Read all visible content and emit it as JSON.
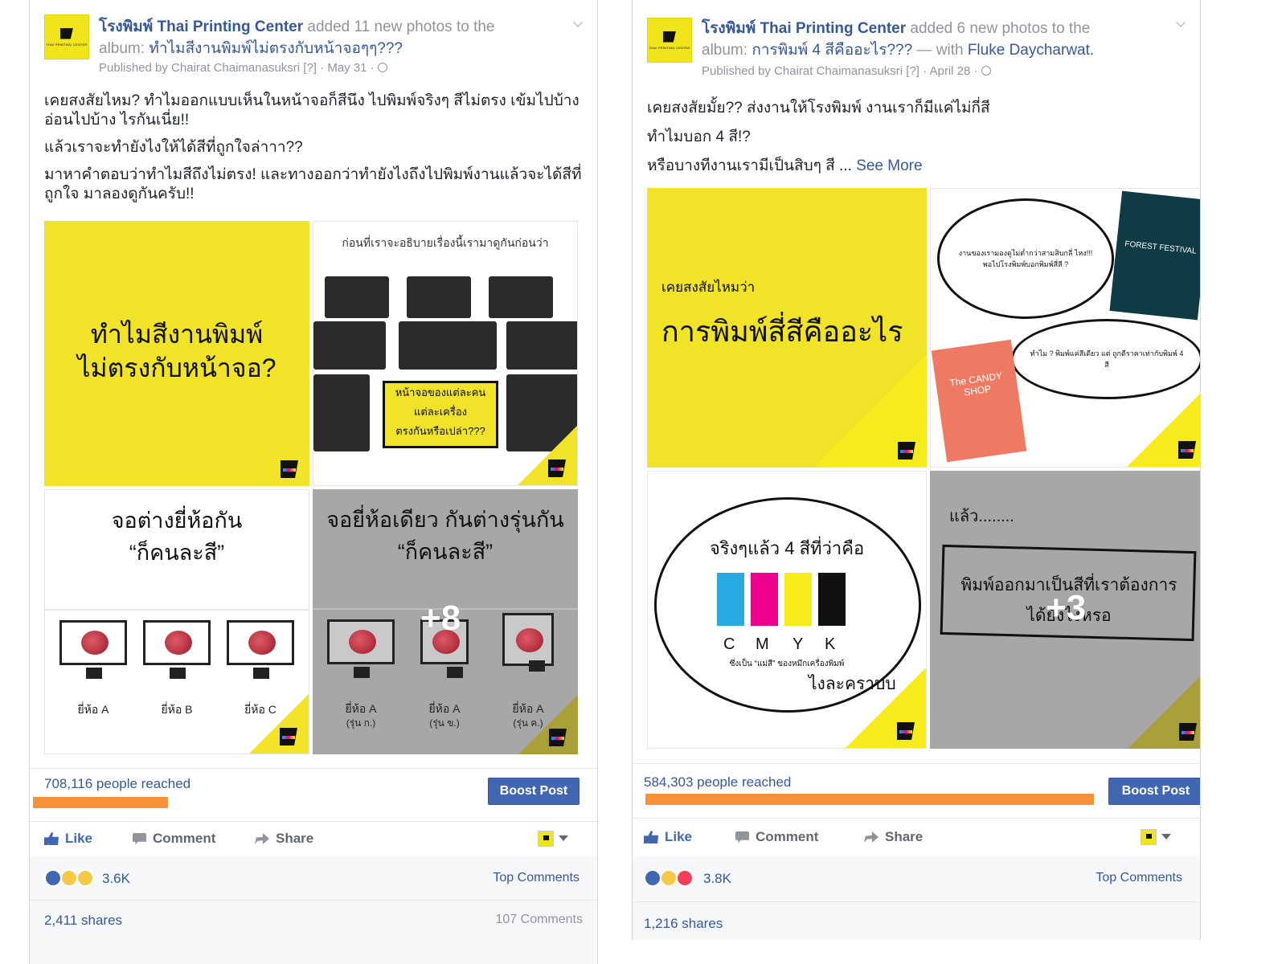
{
  "posts": [
    {
      "page_name": "โรงพิมพ์ Thai Printing Center",
      "action": "added 11 new photos to the",
      "album_prefix": "album:",
      "album": "ทำไมสีงานพิมพ์ไม่ตรงกับหน้าจอๆๆ???",
      "published_by": "Published by Chairat Chaimanasuksri",
      "help_marker": "[?]",
      "date": "May 31",
      "logo_text": "THAI PRINTING CENTER",
      "body": [
        "เคยสงสัยไหม? ทำไมออกแบบเห็นในหน้าจอก็สีนึง ไปพิมพ์จริงๆ สีไม่ตรง เข้มไปบ้าง อ่อนไปบ้าง ไรกันเนี่ย!!",
        "แล้วเราจะทำยังไงให้ได้สีที่ถูกใจล่าาา??",
        "มาหาคำตอบว่าทำไมสีถึงไม่ตรง! และทางออกว่าทำยังไงถึงไปพิมพ์งานแล้วจะได้สีที่ถูกใจ มาลองดูกันครับ!!"
      ],
      "photos": {
        "p1_text": [
          "ทำไมสีงานพิมพ์",
          "ไม่ตรงกับหน้าจอ?"
        ],
        "p2_caption": "ก่อนที่เราจะอธิบายเรื่องนี้เรามาดูกันก่อนว่า",
        "p2_note": [
          "หน้าจอของแต่ละคน",
          "แต่ละเครื่อง",
          "ตรงกันหรือเปล่า???"
        ],
        "p3_title": [
          "จอต่างยี่ห้อกัน",
          "“ก็คนละสี”"
        ],
        "p3_brands": [
          "ยี่ห้อ A",
          "ยี่ห้อ B",
          "ยี่ห้อ C"
        ],
        "p4_title": [
          "จอยี่ห้อเดียว กันต่างรุ่นกัน",
          "“ก็คนละสี”"
        ],
        "p4_brands": [
          "ยี่ห้อ A",
          "ยี่ห้อ A",
          "ยี่ห้อ A"
        ],
        "p4_models": [
          "(รุ่น ก.)",
          "(รุ่น ข.)",
          "(รุ่น ค.)"
        ],
        "more_count": "+8"
      },
      "reach": "708,116 people reached",
      "reach_fraction": 0.3,
      "boost_label": "Boost Post",
      "actions": {
        "like": "Like",
        "comment": "Comment",
        "share": "Share"
      },
      "reactions_count": "3.6K",
      "top_comments": "Top Comments",
      "shares": "2,411 shares",
      "comments_count": "107 Comments"
    },
    {
      "page_name": "โรงพิมพ์ Thai Printing Center",
      "action": "added 6 new photos to the",
      "album_prefix": "album:",
      "album": "การพิมพ์ 4 สีคืออะไร???",
      "with_text": "— with",
      "tagged": "Fluke Daycharwat.",
      "published_by": "Published by Chairat Chaimanasuksri",
      "help_marker": "[?]",
      "date": "April 28",
      "logo_text": "THAI PRINTING CENTER",
      "body": [
        "เคยสงสัยมั้ย?? ส่งงานให้โรงพิมพ์ งานเราก็มีแค่ไม่กี่สี",
        "ทำไมบอก 4 สี!?",
        "หรือบางทีงานเรามีเป็นสิบๆ สี ..."
      ],
      "see_more": "See More",
      "photos": {
        "p1_small": "เคยสงสัยไหมว่า",
        "p1_big": "การพิมพ์สี่สีคืออะไร",
        "p2_bubble1": "งานของเรามองดูไม่ต่ำกว่าสามสิบกลี่ ไหง!!! พอไปโรงพิมพ์บอกพิมพ์สี่สี ?",
        "p2_bubble2": "ทำไม ? พิมพ์แค่สีเดียว แต่ ถูกดีราคาเท่ากับพิมพ์ 4 สี",
        "p2_poster1": "FOREST FESTIVAL",
        "p2_poster2": "The CANDY SHOP",
        "p3_title": "จริงๆแล้ว 4 สีที่ว่าคือ",
        "p3_letters": [
          "C",
          "M",
          "Y",
          "K"
        ],
        "p3_sub": "ซึ่งเป็น “แม่สี” ของหมึกเครื่องพิมพ์",
        "p3_sub2": "ไงละคราบบ",
        "p4_top": "แล้ว........",
        "p4_frame": [
          "พิมพ์ออกมาเป็นสีที่เราต้องการ",
          "ได้ยังไงหรอ"
        ],
        "more_count": "+3"
      },
      "reach": "584,303 people reached",
      "reach_fraction": 0.9,
      "boost_label": "Boost Post",
      "actions": {
        "like": "Like",
        "comment": "Comment",
        "share": "Share"
      },
      "reactions_count": "3.8K",
      "top_comments": "Top Comments",
      "shares": "1,216 shares"
    }
  ],
  "colors": {
    "brand_yellow": "#f0e328",
    "facebook_blue": "#4267b2",
    "link_blue": "#365899",
    "reach_bar": "#f7923a",
    "cmyk": [
      "#29abe2",
      "#ec008c",
      "#f7ec1b",
      "#111111"
    ]
  },
  "icons": [
    "like-icon",
    "comment-icon",
    "share-icon",
    "globe-icon",
    "chevron-down-icon",
    "reaction-like-icon",
    "reaction-haha-icon",
    "reaction-wow-icon",
    "reaction-love-icon"
  ]
}
